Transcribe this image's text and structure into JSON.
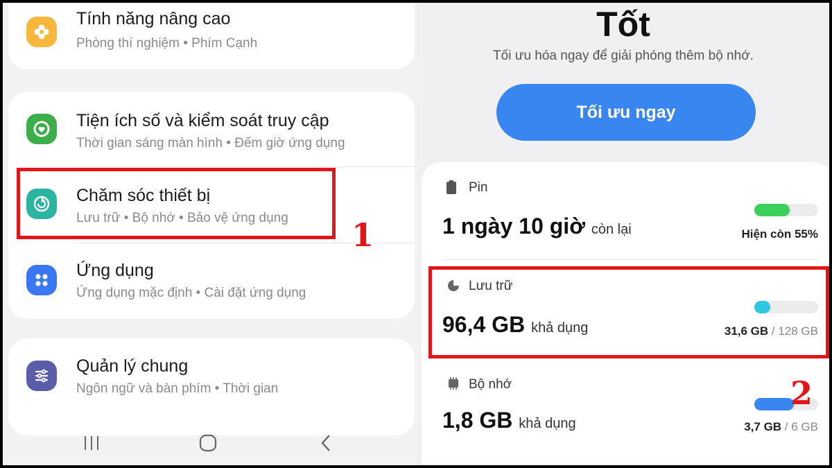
{
  "settings": {
    "items": [
      {
        "title": "Tính năng nâng cao",
        "subtitle": "Phòng thí nghiệm • Phím Cạnh",
        "icon": "plus-flower-icon",
        "color": "#f6b73c"
      },
      {
        "title": "Tiện ích số và kiểm soát truy cập",
        "subtitle": "Thời gian sáng màn hình • Đếm giờ ứng dụng",
        "icon": "digital-wellbeing-icon",
        "color": "#3dae4a"
      },
      {
        "title": "Chăm sóc thiết bị",
        "subtitle": "Lưu trữ • Bộ nhớ • Bảo vệ ứng dụng",
        "icon": "device-care-icon",
        "color": "#2bb5a0"
      },
      {
        "title": "Ứng dụng",
        "subtitle": "Ứng dụng mặc định • Cài đặt ứng dụng",
        "icon": "apps-grid-icon",
        "color": "#3a78f2"
      },
      {
        "title": "Quản lý chung",
        "subtitle": "Ngôn ngữ và bàn phím • Thời gian",
        "icon": "sliders-icon",
        "color": "#5a5ea8"
      }
    ],
    "nav": {
      "recent": "recents-icon",
      "home": "home-icon",
      "back": "back-icon"
    }
  },
  "device_care": {
    "status": "Tốt",
    "hint": "Tối ưu hóa ngay để giải phóng thêm bộ nhớ.",
    "optimize_button": "Tối ưu ngay",
    "battery": {
      "label": "Pin",
      "value": "1 ngày 10 giờ",
      "suffix": "còn lại",
      "stat": "Hiện còn 55%",
      "level": 0.55,
      "color": "#3ccf5a"
    },
    "storage": {
      "label": "Lưu trữ",
      "value": "96,4 GB",
      "suffix": "khả dụng",
      "used": "31,6 GB",
      "sep": " / ",
      "total": "128 GB",
      "level": 0.247,
      "color": "#2ec6e0"
    },
    "memory": {
      "label": "Bộ nhớ",
      "value": "1,8 GB",
      "suffix": "khả dụng",
      "used": "3,7 GB",
      "sep": " / ",
      "total": "6 GB",
      "level": 0.62,
      "color": "#3a86f0"
    }
  },
  "annotations": {
    "marker_1": "1",
    "marker_2": "2"
  }
}
